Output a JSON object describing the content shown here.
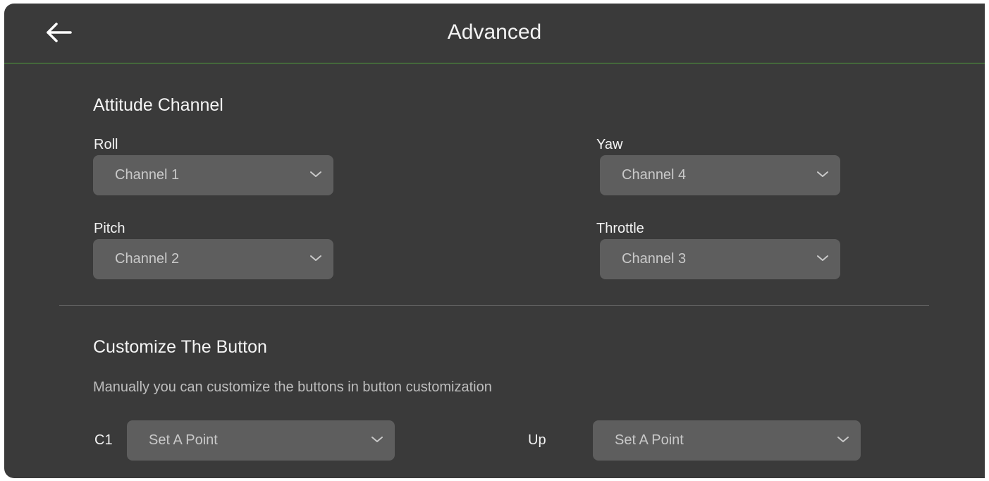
{
  "header": {
    "title": "Advanced",
    "back_icon": "arrow-left-icon"
  },
  "attitude": {
    "title": "Attitude Channel",
    "roll": {
      "label": "Roll",
      "value": "Channel 1"
    },
    "yaw": {
      "label": "Yaw",
      "value": "Channel 4"
    },
    "pitch": {
      "label": "Pitch",
      "value": "Channel 2"
    },
    "throttle": {
      "label": "Throttle",
      "value": "Channel 3"
    }
  },
  "customize": {
    "title": "Customize The Button",
    "description": "Manually you can customize the buttons in button customization",
    "c1": {
      "label": "C1",
      "value": "Set A Point"
    },
    "up": {
      "label": "Up",
      "value": "Set A Point"
    }
  },
  "colors": {
    "panel_bg": "#3a3a3a",
    "select_bg": "#5e5e5e",
    "accent_line": "#4f9e3c"
  },
  "icons": {
    "dropdown": "chevron-down-icon"
  }
}
